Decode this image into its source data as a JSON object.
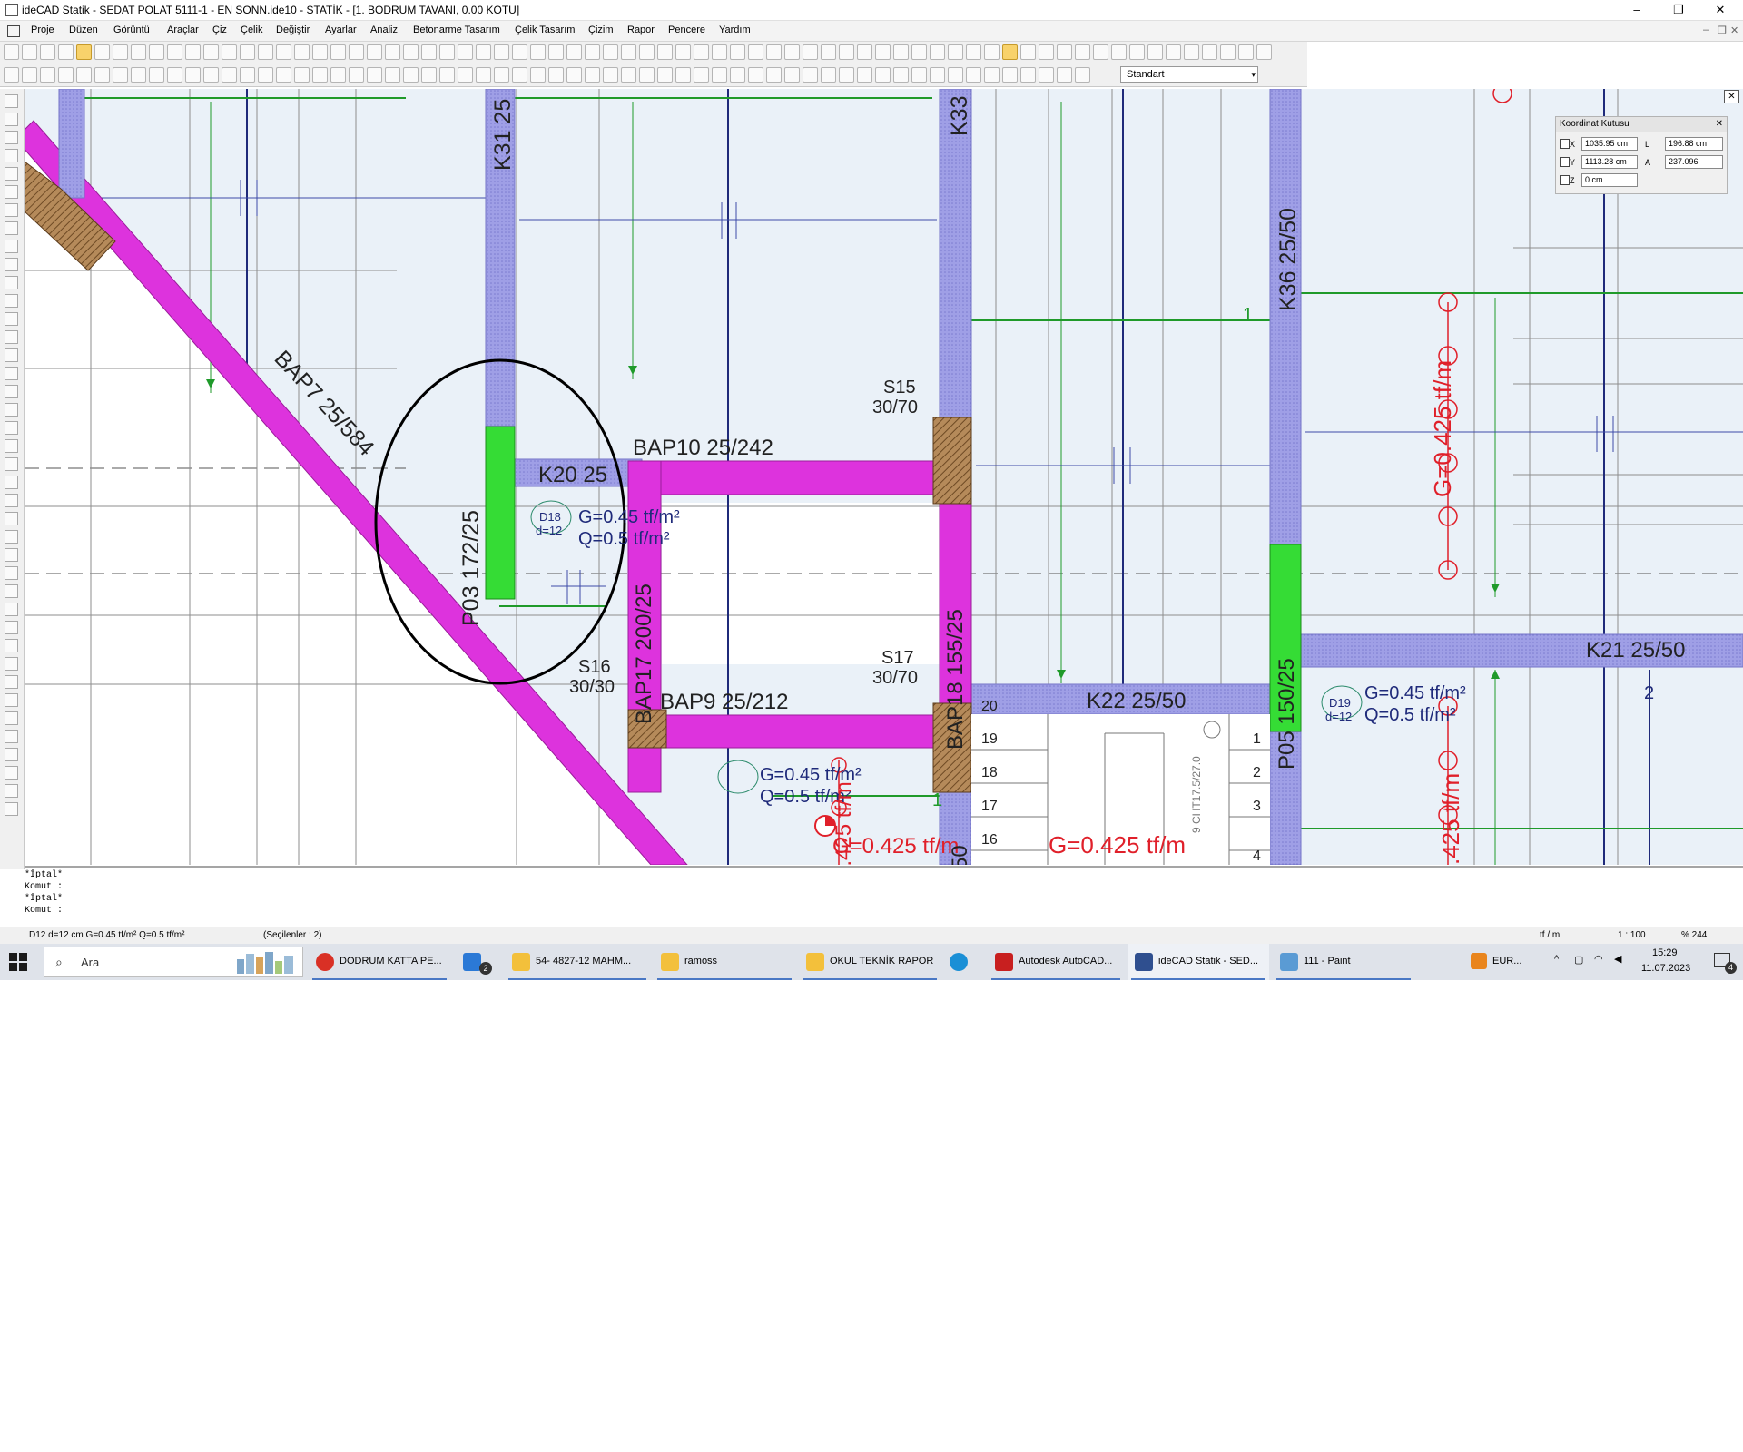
{
  "window": {
    "title": "ideCAD Statik - SEDAT POLAT 5111-1 - EN SONN.ide10 - STATİK - [1. BODRUM TAVANI,  0.00 KOTU]",
    "min_glyph": "–",
    "max_glyph": "❐",
    "close_glyph": "✕"
  },
  "menu": {
    "items": [
      "Proje",
      "Düzen",
      "Görüntü",
      "Araçlar",
      "Çiz",
      "Çelik",
      "Değiştir",
      "Ayarlar",
      "Analiz",
      "Betonarme Tasarım",
      "Çelik Tasarım",
      "Çizim",
      "Rapor",
      "Pencere",
      "Yardım"
    ],
    "inner_controls": [
      "–",
      "❐",
      "✕"
    ]
  },
  "toolbar": {
    "style_combo_value": "Standart",
    "combo_arrow": "▾"
  },
  "coord_box": {
    "title": "Koordinat Kutusu",
    "close_glyph": "✕",
    "x_label": "X",
    "x_value": "1035.95 cm",
    "y_label": "Y",
    "y_value": "1113.28 cm",
    "z_label": "Z",
    "z_value": "0 cm",
    "l_label": "L",
    "l_value": "196.88 cm",
    "a_label": "A",
    "a_value": "237.096"
  },
  "canvas_close_glyph": "✕",
  "drawing": {
    "labels": {
      "bap7": "BAP7 25/584",
      "k31": "K31 25",
      "k33": "K33",
      "k36": "K36 25/50",
      "bap10": "BAP10 25/242",
      "k20": "K20 25",
      "s15": "S15",
      "s15_dim": "30/70",
      "p03": "P03 172/25",
      "d18": "D18",
      "d18_d": "d=12",
      "d18_g": "G=0.45 tf/m²",
      "d18_q": "Q=0.5 tf/m²",
      "bap17": "BAP17 200/25",
      "s16": "S16",
      "s16_dim": "30/30",
      "bap9": "BAP9 25/212",
      "s17": "S17",
      "s17_dim": "30/70",
      "bap18": "BAP18 155/25",
      "k22": "K22 25/50",
      "p05": "P05 150/25",
      "k21": "K21 25/50",
      "d19": "D19",
      "d19_d": "d=12",
      "d19_g": "G=0.45 tf/m²",
      "d19_q": "Q=0.5 tf/m²",
      "d20_g": "G=0.45 tf/m²",
      "d20_q": "Q=0.5 tf/m²",
      "g_load_vertical": "G=0.425 tf/m",
      "g_load_bottom_right": ".425 tf/m",
      "g_load_mid_vertical": "0.425 tf/m",
      "g_load_bottom_1": "G=0.425 tf/m",
      "g_load_bottom_2": "G=0.425 tf/m",
      "slab_no_1": "1",
      "slab_no_1b": "1",
      "slab_no_2": "2",
      "k36_50": "50",
      "stair_label": "9 CHT17.5/27.0",
      "bap_lower": "BAP"
    },
    "stair_steps_left": [
      "20",
      "19",
      "18",
      "17",
      "16"
    ],
    "stair_steps_right": [
      "1",
      "2",
      "3",
      "4"
    ]
  },
  "command": {
    "lines": [
      "*İptal*",
      "Komut :",
      "*İptal*",
      "Komut :"
    ]
  },
  "status": {
    "selection": "D12 d=12 cm G=0.45 tf/m² Q=0.5 tf/m²",
    "selected_count": "(Seçilenler : 2)",
    "unit": "tf / m",
    "scale": "1 : 100",
    "zoom": "% 244"
  },
  "taskbar": {
    "search_placeholder": "Ara",
    "apps": [
      {
        "label": "DODRUM KATTA PE...",
        "icon_color": "#d93025"
      },
      {
        "label": "",
        "icon_color": "#2b79d6"
      },
      {
        "label": "54- 4827-12 MAHM...",
        "icon_color": "#f3c03b"
      },
      {
        "label": "ramoss",
        "icon_color": "#f3c03b"
      },
      {
        "label": "OKUL TEKNİK RAPOR",
        "icon_color": "#f3c03b"
      },
      {
        "label": "",
        "icon_color": "#1a8fd6"
      },
      {
        "label": "Autodesk AutoCAD...",
        "icon_color": "#c81f1f"
      },
      {
        "label": "ideCAD Statik - SED...",
        "icon_color": "#2f4f8f"
      },
      {
        "label": "111 - Paint",
        "icon_color": "#5a9bd4"
      }
    ],
    "badge": "2",
    "currency": "EUR...",
    "time": "15:29",
    "date": "11.07.2023",
    "notif": "4"
  }
}
